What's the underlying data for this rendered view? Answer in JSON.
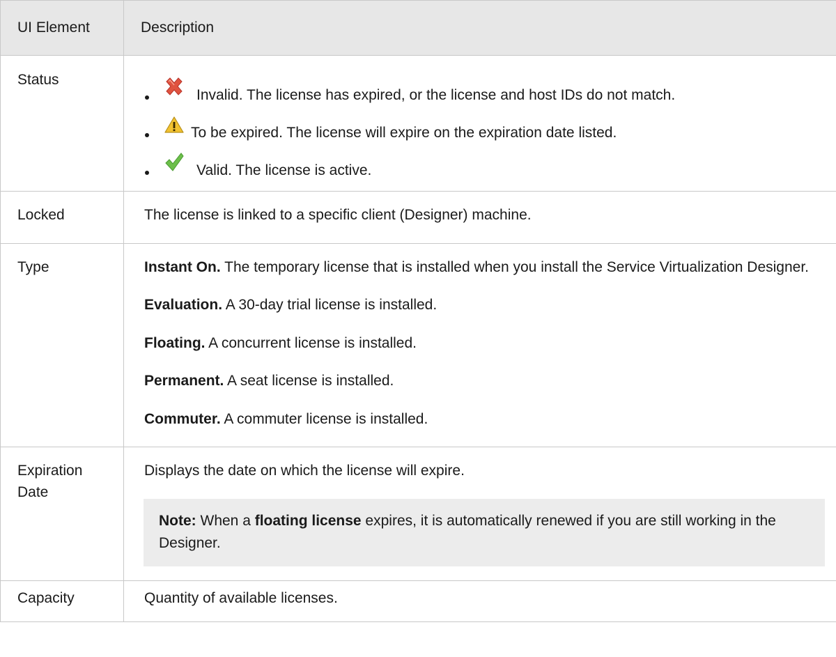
{
  "table": {
    "header": {
      "col1": "UI Element",
      "col2": "Description"
    },
    "rows": {
      "status": {
        "element": "Status",
        "bullets": [
          {
            "icon": "red-x-icon",
            "text": "Invalid. The license has expired, or the license and host IDs do not match."
          },
          {
            "icon": "warning-triangle-icon",
            "text": "To be expired. The license will expire on the expiration date listed."
          },
          {
            "icon": "green-check-icon",
            "text": "Valid. The license is active."
          }
        ]
      },
      "locked": {
        "element": "Locked",
        "description": "The license is linked to a specific client (Designer) machine."
      },
      "type": {
        "element": "Type",
        "items": [
          {
            "term": "Instant On.",
            "text": " The temporary license that is installed when you install the Service Virtualization Designer."
          },
          {
            "term": "Evaluation.",
            "text": " A 30-day trial license is installed."
          },
          {
            "term": "Floating.",
            "text": " A concurrent license is installed."
          },
          {
            "term": "Permanent.",
            "text": " A seat license is installed."
          },
          {
            "term": "Commuter.",
            "text": " A commuter license is installed."
          }
        ]
      },
      "expiration": {
        "element": "Expiration Date",
        "description": "Displays the date on which the license will expire.",
        "note": {
          "label": "Note:",
          "text_before": " When a ",
          "bold": "floating license",
          "text_after": " expires, it is automatically renewed if you are still working in the Designer."
        }
      },
      "capacity": {
        "element": "Capacity",
        "description": "Quantity of available licenses."
      }
    }
  },
  "colors": {
    "header_bg": "#e7e7e7",
    "border": "#c8c8c8",
    "note_bg": "#ececec",
    "invalid_icon": "#e0533f",
    "warning_icon": "#f2c230",
    "valid_icon": "#6cbf4a"
  }
}
